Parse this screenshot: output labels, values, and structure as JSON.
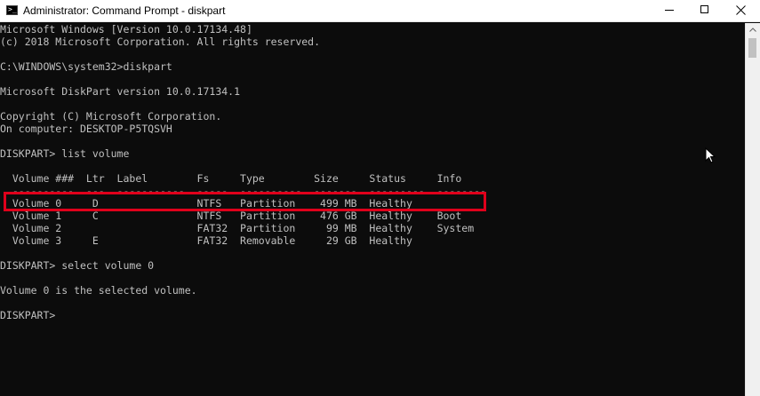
{
  "window": {
    "title": "Administrator: Command Prompt - diskpart",
    "icon": "cmd-icon",
    "controls": {
      "minimize": "minimize-icon",
      "maximize": "maximize-icon",
      "close": "close-icon"
    }
  },
  "console": {
    "lines": [
      "Microsoft Windows [Version 10.0.17134.48]",
      "(c) 2018 Microsoft Corporation. All rights reserved.",
      "",
      "C:\\WINDOWS\\system32>diskpart",
      "",
      "Microsoft DiskPart version 10.0.17134.1",
      "",
      "Copyright (C) Microsoft Corporation.",
      "On computer: DESKTOP-P5TQSVH",
      "",
      "DISKPART> list volume",
      "",
      "  Volume ###  Ltr  Label        Fs     Type        Size     Status     Info",
      "  ----------  ---  -----------  -----  ----------  -------  ---------  --------",
      "  Volume 0     D                NTFS   Partition    499 MB  Healthy",
      "  Volume 1     C                NTFS   Partition    476 GB  Healthy    Boot",
      "  Volume 2                      FAT32  Partition     99 MB  Healthy    System",
      "  Volume 3     E                FAT32  Removable     29 GB  Healthy",
      "",
      "DISKPART> select volume 0",
      "",
      "Volume 0 is the selected volume.",
      "",
      "DISKPART> "
    ]
  },
  "colors": {
    "console_bg": "#0c0c0c",
    "console_text": "#c0c0c0",
    "highlight": "#e0001b"
  }
}
